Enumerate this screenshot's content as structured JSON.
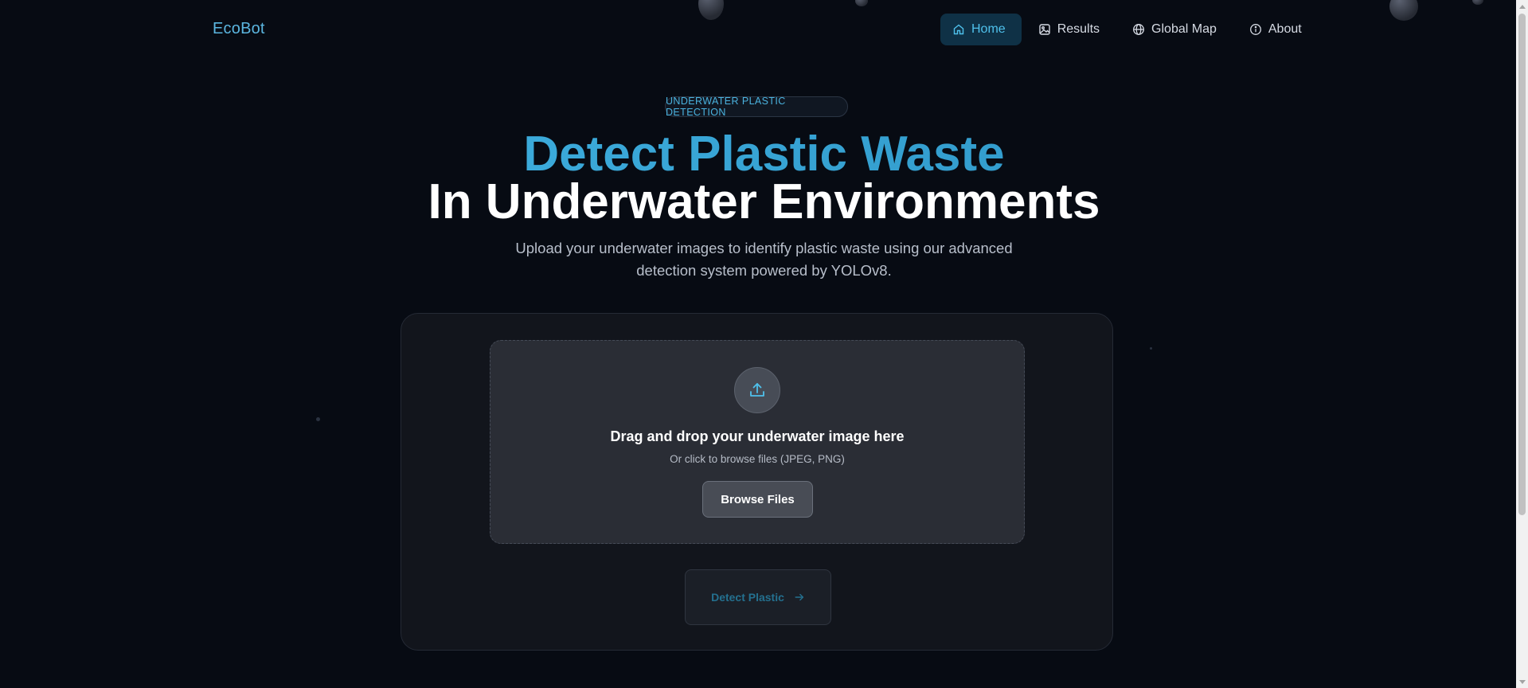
{
  "brand": "EcoBot",
  "nav": {
    "items": [
      {
        "label": "Home",
        "icon": "home-icon",
        "active": true
      },
      {
        "label": "Results",
        "icon": "image-icon",
        "active": false
      },
      {
        "label": "Global Map",
        "icon": "globe-icon",
        "active": false
      },
      {
        "label": "About",
        "icon": "info-icon",
        "active": false
      }
    ]
  },
  "hero": {
    "badge": "UNDERWATER PLASTIC DETECTION",
    "title_line1": "Detect Plastic Waste",
    "title_line2": "In Underwater Environments",
    "subtitle_line1": "Upload your underwater images to identify plastic waste using our advanced",
    "subtitle_line2": "detection system powered by YOLOv8."
  },
  "upload": {
    "icon": "upload-icon",
    "title": "Drag and drop your underwater image here",
    "subtitle": "Or click to browse files (JPEG, PNG)",
    "browse_label": "Browse Files"
  },
  "detect": {
    "label": "Detect Plastic",
    "icon": "arrow-right-icon",
    "disabled": true
  },
  "colors": {
    "accent": "#4fc1ec",
    "background": "#070b13",
    "card": "#12151c",
    "dropzone": "#2a2d35"
  }
}
